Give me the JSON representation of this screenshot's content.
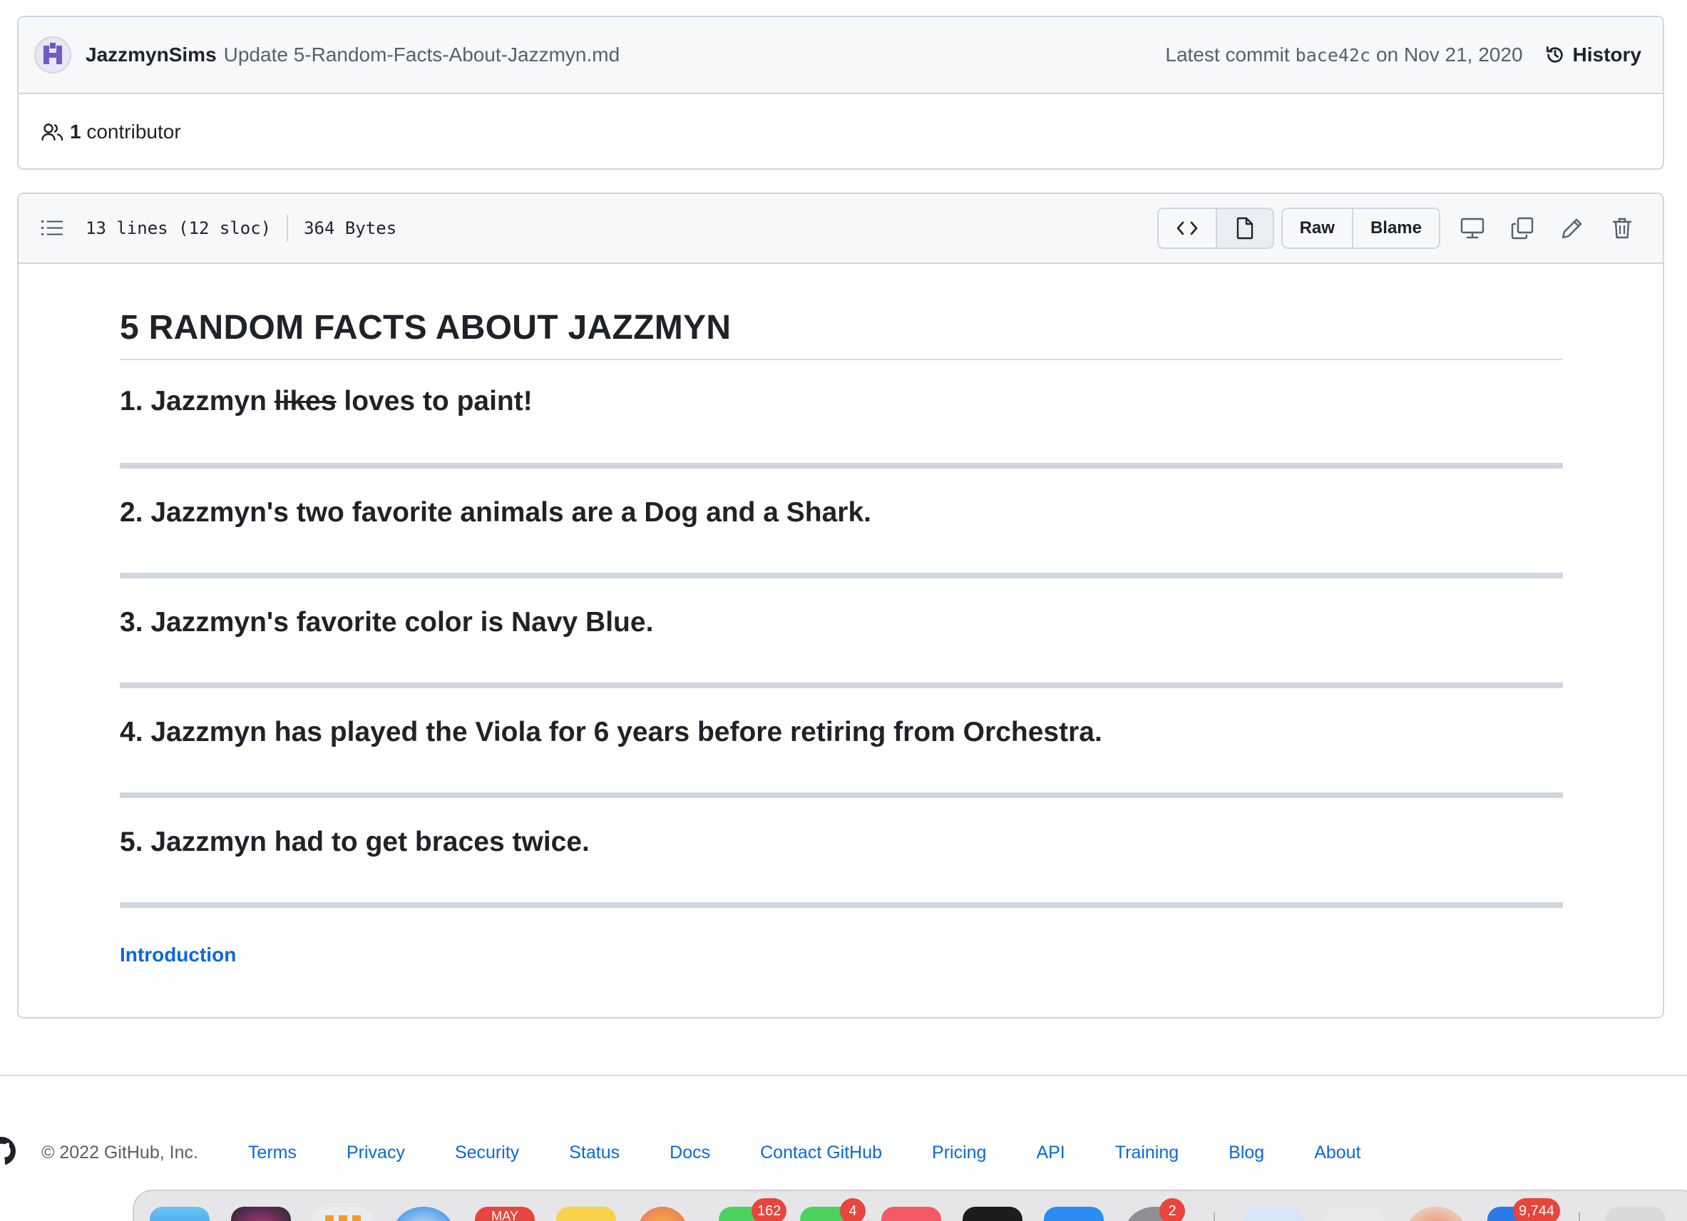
{
  "commit": {
    "author": "JazzmynSims",
    "message": "Update 5-Random-Facts-About-Jazzmyn.md",
    "latest_label": "Latest commit",
    "sha": "bace42c",
    "date_text": "on Nov 21, 2020",
    "history_label": "History"
  },
  "contributors": {
    "count_text": "1",
    "label": "contributor"
  },
  "file": {
    "lines_info": "13 lines (12 sloc)",
    "size_info": "364 Bytes",
    "raw_label": "Raw",
    "blame_label": "Blame"
  },
  "content": {
    "heading": "5 RANDOM FACTS ABOUT JAZZMYN",
    "fact1_prefix": "1. Jazzmyn ",
    "fact1_strike": "likes",
    "fact1_suffix": " loves to paint!",
    "facts": [
      "2. Jazzmyn's two favorite animals are a Dog and a Shark.",
      "3. Jazzmyn's favorite color is Navy Blue.",
      "4. Jazzmyn has played the Viola for 6 years before retiring from Orchestra.",
      "5. Jazzmyn had to get braces twice."
    ],
    "intro_link": "Introduction"
  },
  "footer": {
    "copyright": "© 2022 GitHub, Inc.",
    "links": [
      "Terms",
      "Privacy",
      "Security",
      "Status",
      "Docs",
      "Contact GitHub",
      "Pricing",
      "API",
      "Training",
      "Blog",
      "About"
    ]
  },
  "dock": {
    "calendar_month": "MAY",
    "badges": [
      "162",
      "4",
      "2",
      "9,744"
    ]
  },
  "colors": {
    "link": "#0969da",
    "border": "#d0d7de",
    "header_bg": "#f6f8fa",
    "badge": "#e8453c"
  }
}
